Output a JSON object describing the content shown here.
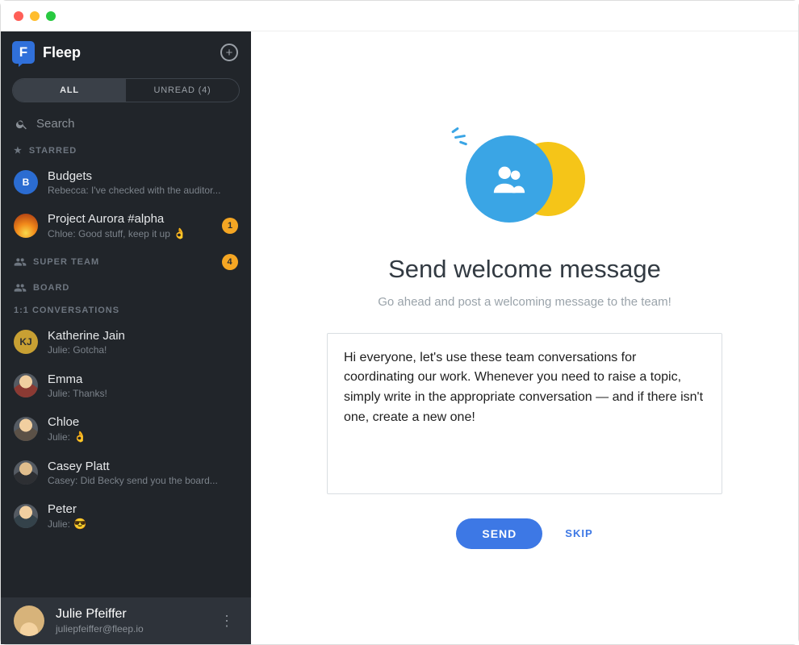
{
  "brand": {
    "logo_letter": "F",
    "name": "Fleep"
  },
  "tabs": {
    "all": "ALL",
    "unread": "UNREAD (4)",
    "unread_count": 4,
    "active": "all"
  },
  "search": {
    "placeholder": "Search"
  },
  "sections": {
    "starred_label": "STARRED",
    "super_team_label": "SUPER TEAM",
    "super_team_badge": "4",
    "board_label": "BOARD",
    "dm_label": "1:1 CONVERSATIONS"
  },
  "starred": [
    {
      "avatar_letter": "B",
      "avatar_style": "blue",
      "title": "Budgets",
      "preview": "Rebecca: I've checked with the auditor...",
      "badge": null,
      "emoji": null
    },
    {
      "avatar_letter": "",
      "avatar_style": "flame",
      "title": "Project Aurora #alpha",
      "preview": "Chloe: Good stuff, keep it up",
      "badge": "1",
      "emoji": "👌"
    }
  ],
  "dms": [
    {
      "avatar_letter": "KJ",
      "avatar_style": "yellow",
      "name": "Katherine Jain",
      "preview": "Julie: Gotcha!",
      "emoji": null
    },
    {
      "avatar_letter": "",
      "avatar_style": "face-a",
      "name": "Emma",
      "preview": "Julie: Thanks!",
      "emoji": null
    },
    {
      "avatar_letter": "",
      "avatar_style": "face-b",
      "name": "Chloe",
      "preview": "Julie:",
      "emoji": "👌"
    },
    {
      "avatar_letter": "",
      "avatar_style": "face-c",
      "name": "Casey Platt",
      "preview": "Casey: Did Becky send you the board...",
      "emoji": null
    },
    {
      "avatar_letter": "",
      "avatar_style": "face-d",
      "name": "Peter",
      "preview": "Julie:",
      "emoji": "😎"
    }
  ],
  "user": {
    "name": "Julie Pfeiffer",
    "email": "juliepfeiffer@fleep.io"
  },
  "welcome": {
    "title": "Send welcome message",
    "subtitle": "Go ahead and post a welcoming message to the team!",
    "message_value": "Hi everyone, let's use these team conversations for coordinating our work. Whenever you need to raise a topic, simply write in the appropriate conversation — and if there isn't one, create a new one!",
    "send_label": "SEND",
    "skip_label": "SKIP"
  }
}
